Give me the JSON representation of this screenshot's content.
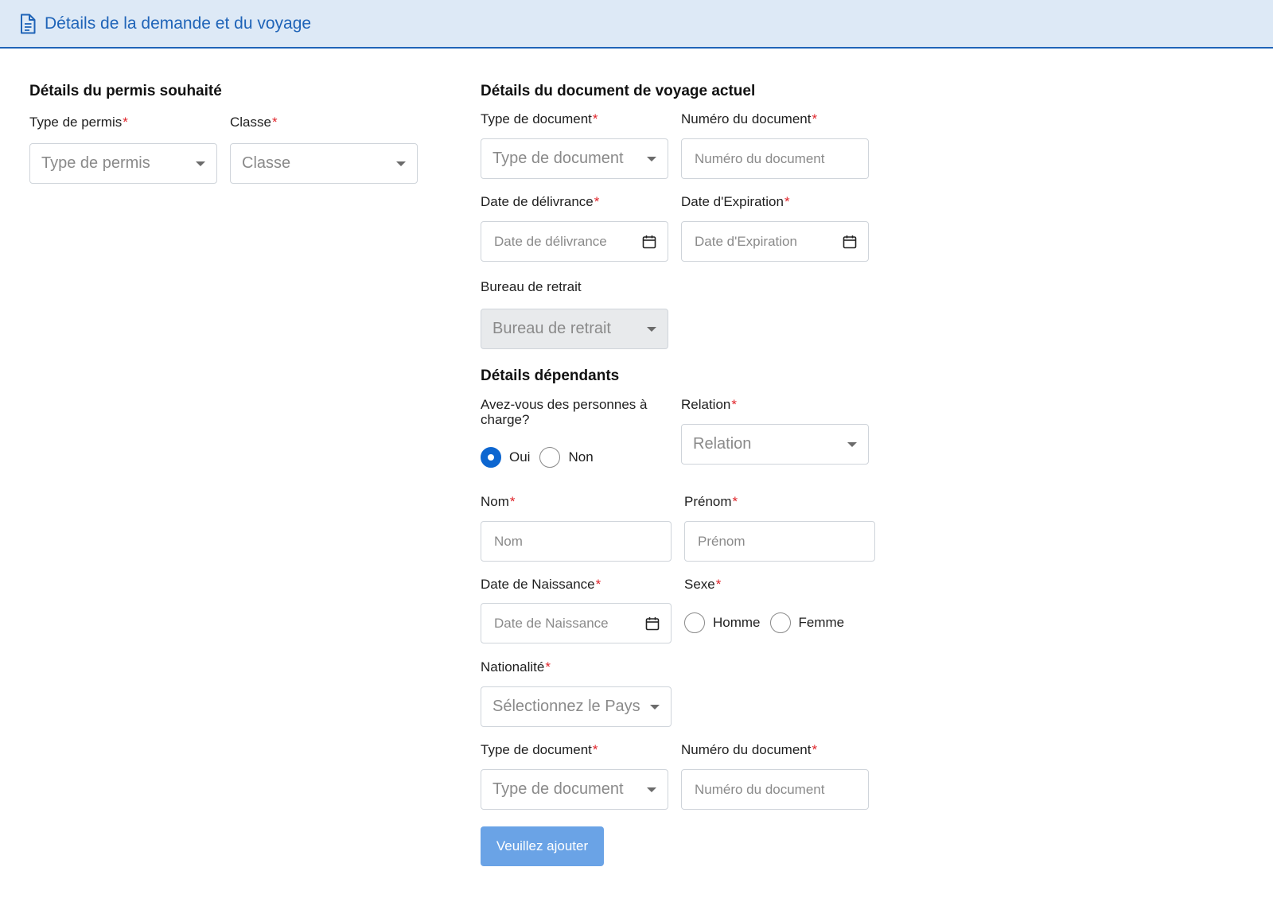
{
  "header": {
    "title": "Détails de la demande et du voyage",
    "icon": "document-icon"
  },
  "permit": {
    "section_title": "Détails du permis souhaité",
    "type_label": "Type de permis",
    "type_placeholder": "Type de permis",
    "class_label": "Classe",
    "class_placeholder": "Classe"
  },
  "travel_doc": {
    "section_title": "Détails du document de voyage actuel",
    "doc_type_label": "Type de document",
    "doc_type_placeholder": "Type de document",
    "doc_number_label": "Numéro du document",
    "doc_number_placeholder": "Numéro du document",
    "issue_date_label": "Date de délivrance",
    "issue_date_placeholder": "Date de délivrance",
    "expiry_date_label": "Date d'Expiration",
    "expiry_date_placeholder": "Date d'Expiration",
    "office_label": "Bureau de retrait",
    "office_placeholder": "Bureau de retrait"
  },
  "dependants": {
    "section_title": "Détails dépendants",
    "question_label": "Avez-vous des personnes à charge?",
    "yes_label": "Oui",
    "no_label": "Non",
    "selected": "Oui",
    "relation_label": "Relation",
    "relation_placeholder": "Relation",
    "last_name_label": "Nom",
    "last_name_placeholder": "Nom",
    "first_name_label": "Prénom",
    "first_name_placeholder": "Prénom",
    "dob_label": "Date de Naissance",
    "dob_placeholder": "Date de Naissance",
    "sex_label": "Sexe",
    "male_label": "Homme",
    "female_label": "Femme",
    "nationality_label": "Nationalité",
    "nationality_placeholder": "Sélectionnez le Pays",
    "doc_type_label": "Type de document",
    "doc_type_placeholder": "Type de document",
    "doc_number_label": "Numéro du document",
    "doc_number_placeholder": "Numéro du document",
    "add_button": "Veuillez ajouter"
  },
  "colors": {
    "accent": "#1f64b8",
    "header_bg": "#dde9f6",
    "required": "#e0242a",
    "button": "#6aa3e6",
    "radio_checked": "#0d66d0"
  }
}
